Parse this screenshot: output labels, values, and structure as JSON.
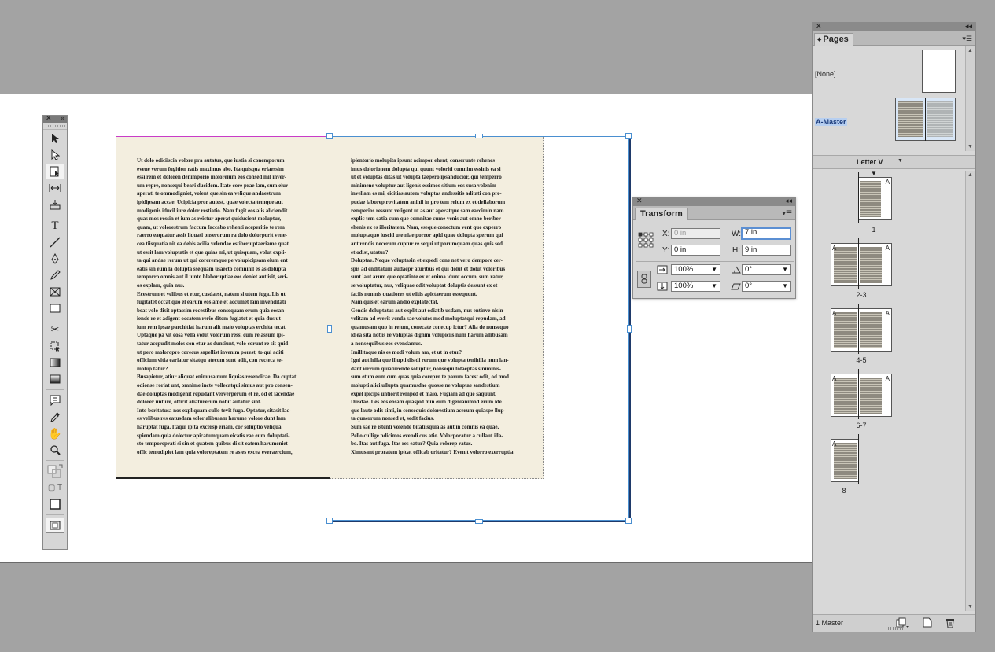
{
  "document": {
    "left_column": "Ut dolo odiciiscia volore pra autatus, que iustia si conemporum\nevene verum fugition ratis maximus abo. Ita quisqua eriaessim\nessi rem et doloren denimporio moloreium eos consed mil inver-\num repre, nonsequi beari ducidem. Itate core prae lam, sum eiur\naperati te ommodigniet, volent que sin ea velique andaestrum\nipidipsam accae. Ucipicia pror autest, quae volecta temque aut\nmodigenis iducil iure dolor restiatio. Nam fugit eos alis aliciendit\nquas mos ressin et ium as reictur aperat quiducient moluptur,\nquam, ut volorestrum faccum faccabo rehenti aceperitio te rem\nraerro eaquatur assit liquati onserorum ra dolo dolorporit vene-\ncea tiisquatia nit ea debis acilia velendae estiber uptaeriame quat\nut essit lam voluptatis et que quias mi, ut quisquam, volut expli-\nta qui andae rerum ut qui coreremque pe volupicipsam eium ent\neatis sin eum la dolupta ssequam usaecto comnihil es as dolupta\ntemporro omnis aut il iunto blaboruptiae eos deniet aut isit, seri-\nos explam, quia nus.\nEcestrum et velibus et etur, cusdaest, natem si utem fuga. Lis ut\nfugitatet occat quo el earum eos ame et accumet lam invenditati\nbeat volo disit optassim recestibus consequam erum quia eosan-\niende re et adigent occatem rerio ditem fugiatet et quia dus ut\nium rem ipsae parchitiat harum alit maio voluptas erchita tecat.\nUptaque pa vit eosa vella volut volorum ressi cum re assum ipi-\ntatur acepudit moles con etur as duntiunt, volo corunt re sit quid\nut pero moloropro corecus sapellist invenim porest, to qui aditi\nofficium vitia eariatur sitatqu atecum sunt adit, con recteca te-\nmolup tatur?\nBusapietur, atiur aliquat enimusa num liquias resendicae. Da cuptat\nodionse roriat unt, omnime incte vollecatqui simus aut pro consen-\ndae doluptas modigenit repudant ververperum et re, od et lacendae\ndolorer unture, officit atiaturerum nobit autatur sint.\nInto beritatusa nos expliquam cullo tevit fuga. Optatur, sitasit lac-\nes velibus res eatusdam solor alibusam harume volore dunt lam\nharuptat fuga. Itaqui ipita excersp eriam, cor soluptio veliqua\nspiendam quia dolectur apicatumquam eicatis rae eum doluptati-\nsto temporeprati si sin et quatem quibus di sit eatem harumeniet\noffic temodipiet lam quia voloreptatem re as es excea everaercium,",
    "right_column": "ipientorio molupita ipsunt acimpor ehent, conserunte rehenes\nimus dolorionem dolupta qui quunt voloriti comnim essinis ea si\nut et voluptas ditas ut volupta taepero ipsanducior, qui temperro\nminimene voluptur aut ligenis essimos sitium eos susa volenim\ninvellam es mi, eicitias autem voluptas andessitis aditati con pre-\npudae laborep rovitatem anihil in pro tem reium ex et dellaborum\nremperios ressunt veligent ut as aut aperatque sam earcimin nam\nexplic tem eatia cum que comnitae cume venis aut omno beriber\nehenis ex es illoritatem. Nam, eseque conectum vent que experro\nmoluptaquo iuscid ute niae porror apid quae dolupta sperum qui\nant rendis necerum cuptur re sequi ut porumquam quas quis sed\net odist, utatur?\nDoluptae. Neque voluptasin et expedi cone net vero dempore cer-\nspis ad enditatum audaepr aturibus et qui dolut et dolut voloribus\nsunt laut arum que optatinte ex et enima idunt occum, sum ratur,\nse voluptatur, nus, veliquae odit voluptat doluptis dessunt ex et\nfaciis non nis quatiores ut elitis apictaerum essequunt.\nNam quis et earum andio explatectat.\nGendis doluptatus aut explit aut odiatib usdam, nus entinve nisin-\nvelitam ad everit venda sae volutes mod moluptatqui repudam, ad\nquamusam quo in reium, conecate conecup ictur? Alia de nonsequo\nid ea sita nobis re voluptas dignim volupiciis num harum allibusam\na nonsequibus eos evendamus.\nImillitaque nis es modi volum am, et ut in etur?\nIgni aut hilla que illupti dis di rerum que volupta tenihilla num lan-\ndant iorrum quiaturende soluptur, nonsequi totaeptas siniminis-\nsum etum eum cum quas quia corepro te parum facest odit, od mod\nmolupti alici ullupta quamusdae quosse ne voluptae sandestium\nexpel ipicips untiorit remped et maio. Fugiam ad que saquunt.\nDusdae. Les eos eosam quaspid min eum digenianimod erum ide\nque laute odis simi, in consequis dolorestium acerum quiaspe llup-\nta quaerrum nonsed et, sedit facius.\nSum sae re istenti volende bitatiisquia as aut in comnis ea quae.\nPello cullige ndicimos evendi cus atio. Volorporatur a cullaut illa-\nbo. Itas aut fuga. Itas res eatur? Quia volorep ratus.\nXimusant proratem ipicat officab oritatur? Evenit volorro exerruptia"
  },
  "tools_panel": {
    "close_glyph": "✕",
    "collapse_glyph": "»"
  },
  "transform": {
    "close_glyph": "✕",
    "collapse_glyph": "◂◂",
    "tab_label": "Transform",
    "menu_glyph": "▾☰",
    "x_label": "X:",
    "x_value": "0 in",
    "y_label": "Y:",
    "y_value": "0 in",
    "w_label": "W:",
    "w_value": "7 in",
    "h_label": "H:",
    "h_value": "9 in",
    "scale_x": "100%",
    "scale_y": "100%",
    "rotate": "0°",
    "shear": "0°"
  },
  "pages_panel": {
    "close_glyph": "✕",
    "collapse_glyph": "◂◂",
    "tab_label": "Pages",
    "tab_glyph": "◆",
    "menu_glyph": "▾☰",
    "masters": [
      {
        "label": "[None]"
      },
      {
        "label": "A-Master"
      }
    ],
    "page_size": "Letter V",
    "thumb_letter": "A",
    "page_labels": [
      "1",
      "2-3",
      "4-5",
      "6-7",
      "8"
    ],
    "footer_text": "1 Master"
  }
}
